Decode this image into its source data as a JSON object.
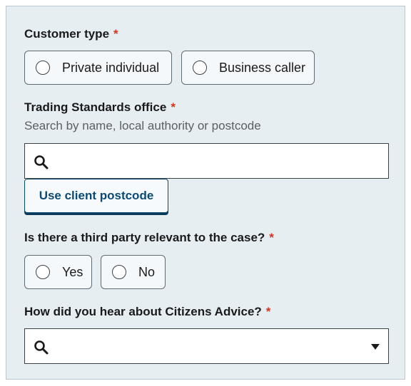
{
  "customer_type": {
    "label": "Customer type",
    "required_mark": "*",
    "options": [
      "Private individual",
      "Business caller"
    ]
  },
  "trading_standards": {
    "label": "Trading Standards office",
    "required_mark": "*",
    "hint": "Search by name, local authority or postcode",
    "search_icon": "search-icon",
    "use_postcode_button": "Use client postcode"
  },
  "third_party": {
    "label": "Is there a third party relevant to the case?",
    "required_mark": "*",
    "options": [
      "Yes",
      "No"
    ]
  },
  "hear_about": {
    "label": "How did you hear about Citizens Advice?",
    "required_mark": "*",
    "search_icon": "search-icon",
    "dropdown_icon": "chevron-down-icon"
  },
  "colors": {
    "panel_bg": "#e6eef2",
    "required": "#d4351c",
    "button_text": "#0b4a75"
  }
}
